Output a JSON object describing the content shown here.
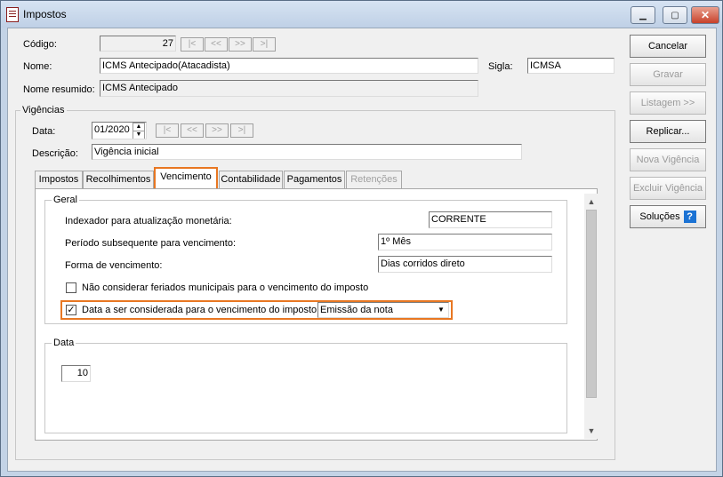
{
  "window": {
    "title": "Impostos",
    "minimize_glyph": "▁",
    "maximize_glyph": "▢",
    "close_glyph": "✕"
  },
  "header": {
    "codigo_label": "Código:",
    "codigo_value": "27",
    "nome_label": "Nome:",
    "nome_value": "ICMS Antecipado(Atacadista)",
    "sigla_label": "Sigla:",
    "sigla_value": "ICMSA",
    "nome_resumido_label": "Nome resumido:",
    "nome_resumido_value": "ICMS Antecipado",
    "nav": [
      "|<",
      "<<",
      ">>",
      ">|"
    ]
  },
  "vigencias": {
    "title": "Vigências",
    "data_label": "Data:",
    "data_value": "01/2020",
    "descricao_label": "Descrição:",
    "descricao_value": "Vigência inicial",
    "nav": [
      "|<",
      "<<",
      ">>",
      ">|"
    ]
  },
  "tabs": [
    "Impostos",
    "Recolhimentos",
    "Vencimento",
    "Contabilidade",
    "Pagamentos",
    "Retenções"
  ],
  "geral": {
    "title": "Geral",
    "indexador_label": "Indexador para atualização monetária:",
    "indexador_value": "CORRENTE",
    "periodo_label": "Período subsequente para vencimento:",
    "periodo_value": "1º Mês",
    "forma_label": "Forma de vencimento:",
    "forma_value": "Dias corridos direto",
    "nao_considerar_label": "Não considerar feriados municipais para o vencimento do imposto",
    "nao_considerar_checked": false,
    "data_considerada_label": "Data a ser considerada para o vencimento do imposto:",
    "data_considerada_checked": true,
    "data_considerada_value": "Emissão da nota"
  },
  "data_group": {
    "title": "Data",
    "value": "10"
  },
  "buttons": {
    "cancelar": "Cancelar",
    "gravar": "Gravar",
    "listagem": "Listagem >>",
    "replicar": "Replicar...",
    "nova_vigencia": "Nova Vigência",
    "excluir_vigencia": "Excluir Vigência",
    "solucoes": "Soluções"
  },
  "icons": {
    "help": "?",
    "check": "✓",
    "combo_arrow": "▼",
    "scroll_up": "▲",
    "scroll_down": "▼"
  },
  "colors": {
    "highlight": "#e87722",
    "help_blue": "#1c73d4"
  }
}
